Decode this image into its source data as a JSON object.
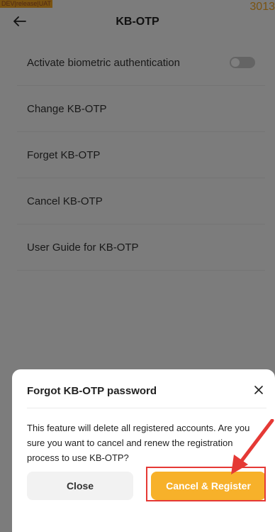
{
  "env_badge": "DEV|release|UAT",
  "corner_number": "3013",
  "header": {
    "title": "KB-OTP",
    "back_icon": "arrow-left-icon"
  },
  "menu": {
    "items": [
      {
        "label": "Activate biometric authentication",
        "toggle_on": false
      },
      {
        "label": "Change KB-OTP"
      },
      {
        "label": "Forget KB-OTP"
      },
      {
        "label": "Cancel KB-OTP"
      },
      {
        "label": "User Guide for KB-OTP"
      }
    ]
  },
  "dialog": {
    "title": "Forgot KB-OTP password",
    "close_icon": "close-icon",
    "message": "This feature will delete all registered accounts. Are you sure you want to cancel and renew the registration process to use KB-OTP?",
    "close_label": "Close",
    "confirm_label": "Cancel & Register"
  },
  "colors": {
    "accent": "#f7b12a",
    "annotation": "#e53935",
    "overlay": "rgba(0,0,0,0.5)"
  }
}
